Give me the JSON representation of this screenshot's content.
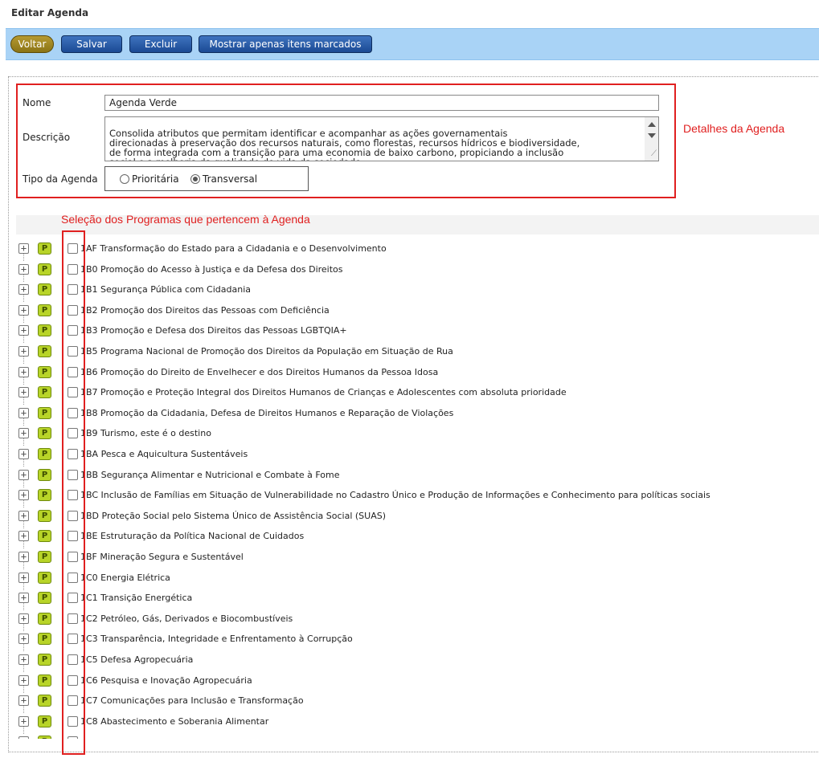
{
  "page_title": "Editar Agenda",
  "toolbar": {
    "back_label": "Voltar",
    "save_label": "Salvar",
    "delete_label": "Excluir",
    "show_marked_label": "Mostrar apenas itens marcados"
  },
  "form": {
    "name_label": "Nome",
    "name_value": "Agenda Verde",
    "description_label": "Descrição",
    "description_value": "Consolida atributos que permitam identificar e acompanhar as ações governamentais\ndirecionadas à preservação dos recursos naturais, como florestas, recursos hídricos e biodiversidade,\nde forma integrada com a transição para uma economia de baixo carbono, propiciando a inclusão\nsocial e a melhoria da qualidade de vida da sociedade.",
    "type_label": "Tipo da Agenda",
    "type_option_1": "Prioritária",
    "type_option_2": "Transversal",
    "type_selected": "Transversal"
  },
  "annotations": {
    "details": "Detalhes da Agenda",
    "programs": "Seleção dos Programas que pertencem à Agenda"
  },
  "programs": [
    "1AF Transformação do Estado para a Cidadania e o Desenvolvimento",
    "1B0 Promoção do Acesso à Justiça e da Defesa dos Direitos",
    "1B1 Segurança Pública com Cidadania",
    "1B2 Promoção dos Direitos das Pessoas com Deficiência",
    "1B3 Promoção e Defesa dos Direitos das Pessoas LGBTQIA+",
    "1B5 Programa Nacional de Promoção dos Direitos da População em Situação de Rua",
    "1B6 Promoção do Direito de Envelhecer e dos Direitos Humanos da Pessoa Idosa",
    "1B7 Promoção e Proteção Integral dos Direitos Humanos de Crianças e Adolescentes com absoluta prioridade",
    "1B8 Promoção da Cidadania, Defesa de Direitos Humanos e Reparação de Violações",
    "1B9 Turismo, este é o destino",
    "1BA Pesca e Aquicultura Sustentáveis",
    "1BB Segurança Alimentar e Nutricional e Combate à Fome",
    "1BC Inclusão de Famílias em Situação de Vulnerabilidade no Cadastro Único e Produção de Informações e Conhecimento para políticas sociais",
    "1BD Proteção Social pelo Sistema Único de Assistência Social (SUAS)",
    "1BE Estruturação da Política Nacional de Cuidados",
    "1BF Mineração Segura e Sustentável",
    "1C0 Energia Elétrica",
    "1C1 Transição Energética",
    "1C2 Petróleo, Gás, Derivados e Biocombustíveis",
    "1C3 Transparência, Integridade e Enfrentamento à Corrupção",
    "1C5 Defesa Agropecuária",
    "1C6 Pesquisa e Inovação Agropecuária",
    "1C7 Comunicações para Inclusão e Transformação",
    "1C8 Abastecimento e Soberania Alimentar"
  ],
  "program_badge": "P",
  "colors": {
    "annotation_red": "#e02020",
    "toolbar_bg": "#a9d3f6",
    "badge_green": "#b8d428"
  }
}
